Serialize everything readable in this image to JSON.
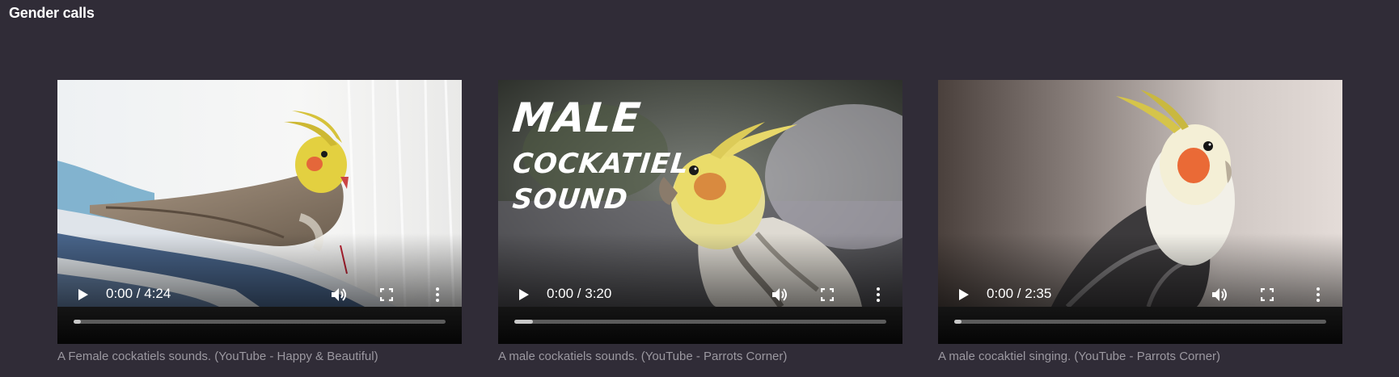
{
  "section": {
    "title": "Gender calls"
  },
  "videos": [
    {
      "current_time": "0:00",
      "duration": "4:24",
      "time_text": "0:00 / 4:24",
      "progress": 0.02,
      "caption": "A Female cockatiels sounds. (YouTube - Happy & Beautiful)",
      "play_icon": "play-icon",
      "volume_icon": "volume-icon",
      "fullscreen_icon": "fullscreen-icon",
      "more_icon": "more-vertical-icon"
    },
    {
      "current_time": "0:00",
      "duration": "3:20",
      "time_text": "0:00 / 3:20",
      "progress": 0.05,
      "caption": "A male cockatiels sounds. (YouTube - Parrots Corner)",
      "overlay_lines": [
        "MALE",
        "COCKATIEL",
        "SOUND"
      ],
      "play_icon": "play-icon",
      "volume_icon": "volume-icon",
      "fullscreen_icon": "fullscreen-icon",
      "more_icon": "more-vertical-icon"
    },
    {
      "current_time": "0:00",
      "duration": "2:35",
      "time_text": "0:00 / 2:35",
      "progress": 0.02,
      "caption": "A male cocaktiel singing. (YouTube - Parrots Corner)",
      "play_icon": "play-icon",
      "volume_icon": "volume-icon",
      "fullscreen_icon": "fullscreen-icon",
      "more_icon": "more-vertical-icon"
    }
  ],
  "colors": {
    "page_background": "#302c37",
    "caption_text": "#9b98a0",
    "progress_track": "#5c5c5c",
    "progress_fill": "#c8c8c8"
  }
}
